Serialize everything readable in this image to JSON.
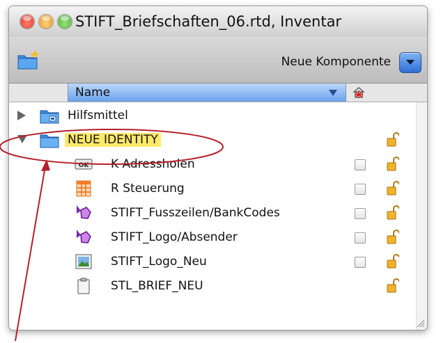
{
  "window": {
    "title": "STIFT_Briefschaften_06.rtd, Inventar"
  },
  "toolbar": {
    "new_component_label": "Neue Komponente"
  },
  "header": {
    "name_column": "Name"
  },
  "rows": [
    {
      "label": "Hilfsmittel"
    },
    {
      "label": "NEUE IDENTITY"
    },
    {
      "label": "K Adressholen"
    },
    {
      "label": "R Steuerung"
    },
    {
      "label": "STIFT_Fusszeilen/BankCodes"
    },
    {
      "label": "STIFT_Logo/Absender"
    },
    {
      "label": "STIFT_Logo_Neu"
    },
    {
      "label": "STL_BRIEF_NEU"
    }
  ],
  "icon_labels": {
    "ok_badge": "OK"
  }
}
